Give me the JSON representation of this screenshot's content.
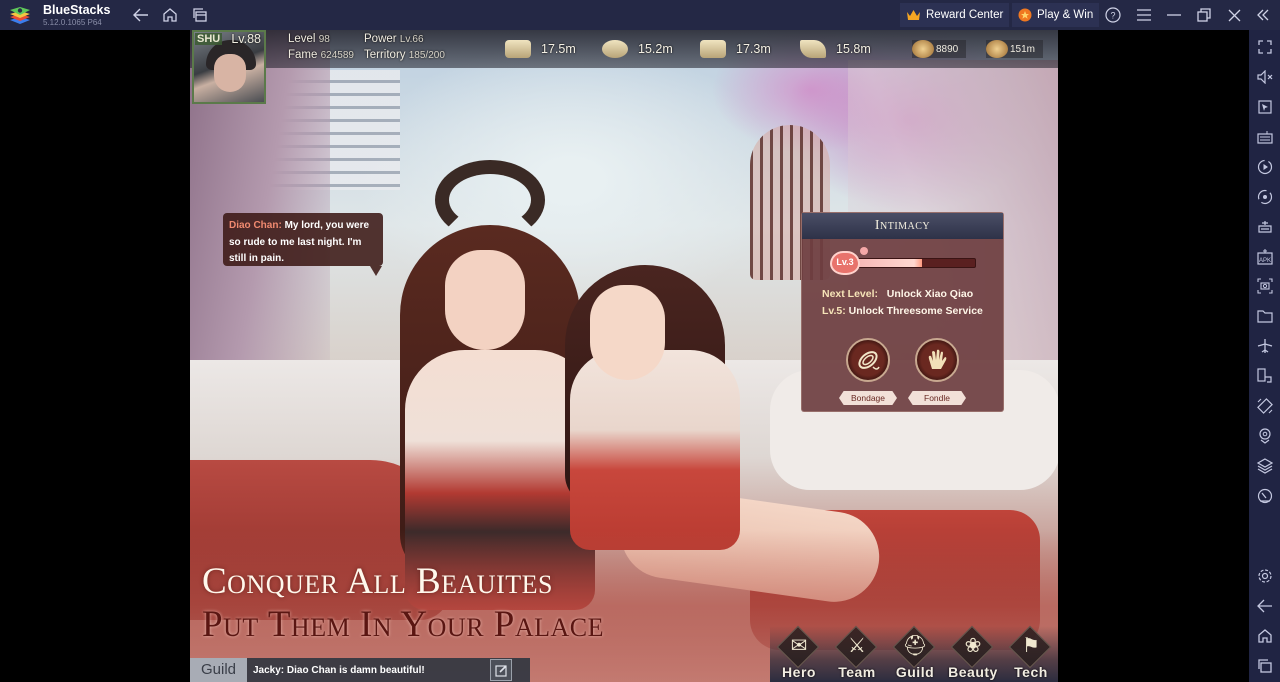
{
  "titlebar": {
    "app_name": "BlueStacks",
    "version": "5.12.0.1065 P64",
    "nav_icons": [
      "back-icon",
      "home-icon",
      "multi-instance-icon"
    ],
    "reward_center_label": "Reward Center",
    "play_win_label": "Play & Win",
    "window_icons": [
      "help-icon",
      "menu-icon",
      "minimize-icon",
      "restore-icon",
      "close-icon",
      "collapse-sidebar-icon"
    ]
  },
  "sidebar": {
    "top_icons": [
      "fullscreen-icon",
      "volume-mute-icon",
      "pointer-icon",
      "keyboard-icon",
      "macro-play-icon",
      "sync-icon",
      "game-controls-icon",
      "install-apk-icon",
      "screenshot-icon",
      "folder-icon",
      "airplane-mode-icon",
      "rotate-icon",
      "shake-icon",
      "location-icon",
      "layers-icon",
      "performance-icon"
    ],
    "bottom_icons": [
      "settings-icon",
      "back-icon",
      "home-icon",
      "recent-apps-icon"
    ]
  },
  "game": {
    "player": {
      "faction": "SHU",
      "avatar_level": "Lv.88",
      "level_label": "Level",
      "level_value": "98",
      "power_label": "Power",
      "power_value": "Lv.66",
      "fame_label": "Fame",
      "fame_value": "624589",
      "territory_label": "Territory",
      "territory_value": "185/200"
    },
    "resources": [
      {
        "icon": "silver-ingot-icon",
        "value": "17.5m"
      },
      {
        "icon": "food-sack-icon",
        "value": "15.2m"
      },
      {
        "icon": "wood-icon",
        "value": "17.3m"
      },
      {
        "icon": "soldiers-icon",
        "value": "15.8m"
      }
    ],
    "currencies": [
      {
        "icon": "gold-icon",
        "value": "8890"
      },
      {
        "icon": "coin-icon",
        "value": "151m"
      }
    ],
    "dialogue": {
      "speaker": "Diao Chan:",
      "text": "My lord, you were so rude to me last night. I'm still in pain."
    },
    "intimacy": {
      "title": "Intimacy",
      "level_badge": "Lv.3",
      "progress": 0.6,
      "next_level_label": "Next Level:",
      "next_level_value": "Unlock Xiao Qiao",
      "lv5_label": "Lv.5:",
      "lv5_value": "Unlock Threesome Service",
      "actions": [
        {
          "icon": "rope-icon",
          "label": "Bondage"
        },
        {
          "icon": "hand-icon",
          "label": "Fondle"
        }
      ]
    },
    "slogan_line1": "Conquer All Beauites",
    "slogan_line2": "Put Them In Your Palace",
    "chat": {
      "tab": "Guild",
      "message": "Jacky:  Diao Chan is damn beautiful!"
    },
    "nav": [
      {
        "icon": "hero-scroll-icon",
        "glyph": "✉",
        "label": "Hero"
      },
      {
        "icon": "team-swords-icon",
        "glyph": "⚔",
        "label": "Team"
      },
      {
        "icon": "guild-helmet-icon",
        "glyph": "⛑",
        "label": "Guild"
      },
      {
        "icon": "beauty-fan-icon",
        "glyph": "❀",
        "label": "Beauty"
      },
      {
        "icon": "tech-banner-icon",
        "glyph": "⚑",
        "label": "Tech"
      }
    ]
  }
}
